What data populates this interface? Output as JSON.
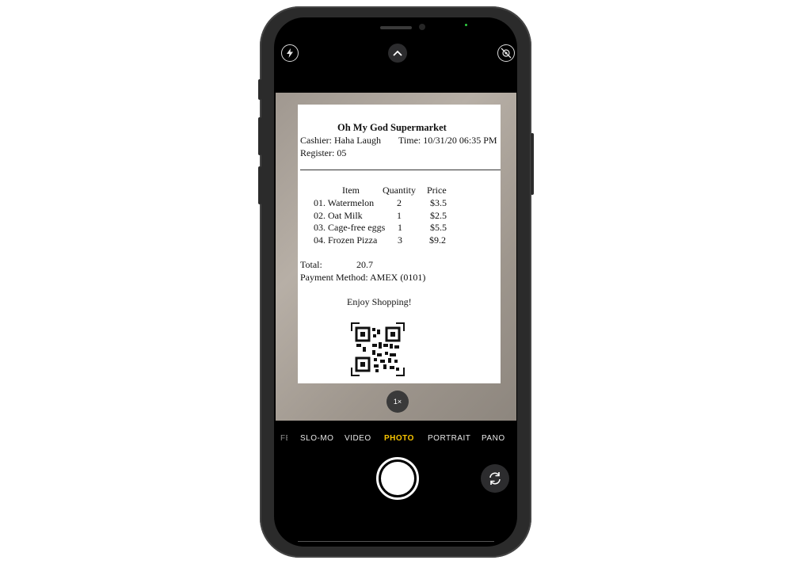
{
  "camera": {
    "zoom_label": "1×",
    "modes": [
      "FE",
      "SLO-MO",
      "VIDEO",
      "PHOTO",
      "PORTRAIT",
      "PANO"
    ],
    "active_mode": "PHOTO",
    "accent_color": "#f7c400"
  },
  "receipt": {
    "store_name": "Oh My God Supermarket",
    "cashier": "Cashier: Haha Laugh",
    "time": "Time: 10/31/20  06:35 PM",
    "register": "Register: 05",
    "columns": [
      "Item",
      "Quantity",
      "Price"
    ],
    "items": [
      {
        "name": "01. Watermelon",
        "qty": "2",
        "price": "$3.5"
      },
      {
        "name": "02.  Oat Milk",
        "qty": "1",
        "price": "$2.5"
      },
      {
        "name": "03. Cage-free eggs",
        "qty": "1",
        "price": "$5.5"
      },
      {
        "name": "04. Frozen Pizza",
        "qty": "3",
        "price": "$9.2"
      }
    ],
    "total_label": "Total:",
    "total_value": "20.7",
    "payment": "Payment Method:  AMEX (0101)",
    "footer": "Enjoy Shopping!"
  },
  "icons": {
    "flash": "flash-icon",
    "chevron": "chevron-up-icon",
    "live_photo": "live-photo-off-icon",
    "flip": "camera-flip-icon",
    "qr": "qr-code-icon"
  }
}
